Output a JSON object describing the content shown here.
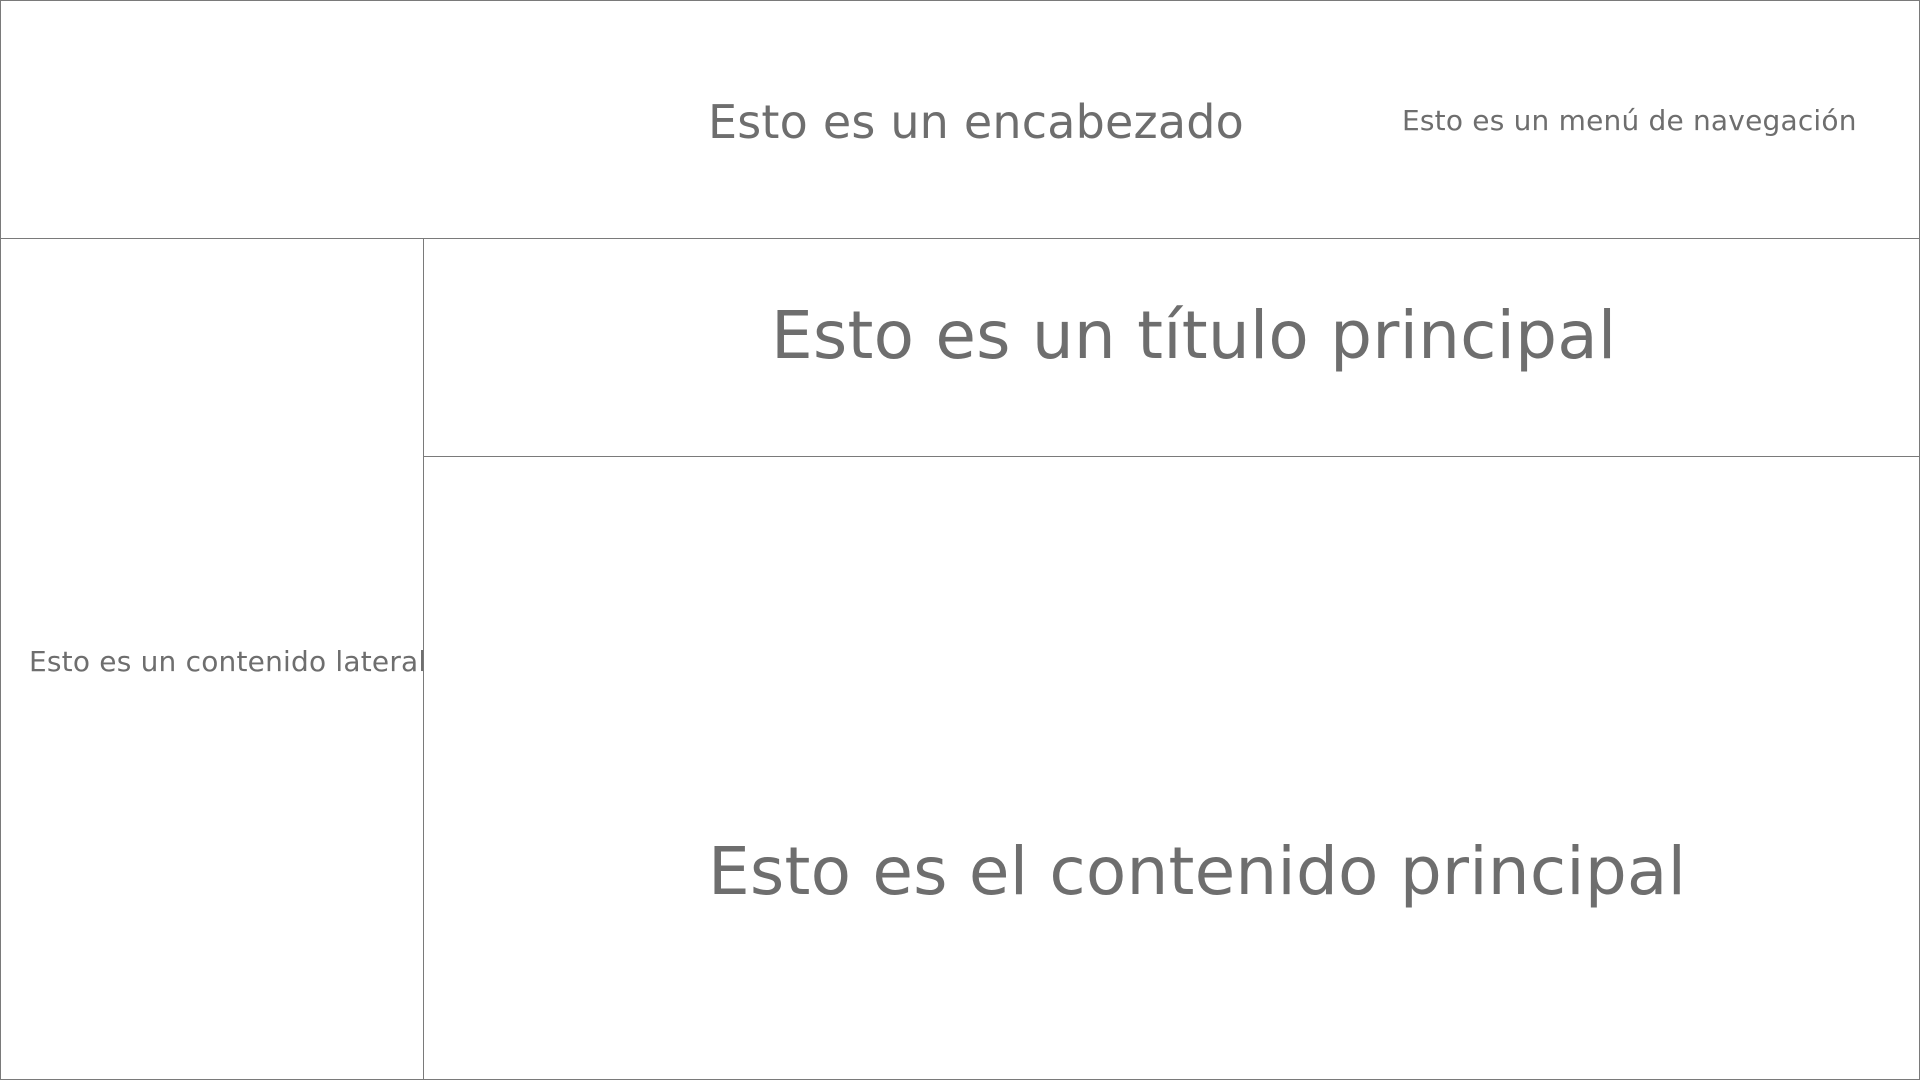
{
  "header": {
    "title": "Esto es un encabezado",
    "nav_menu": "Esto es un menú de navegación"
  },
  "main": {
    "title": "Esto es un título principal",
    "content": "Esto es el contenido principal"
  },
  "sidebar": {
    "content": "Esto es un contenido lateral"
  },
  "colors": {
    "border": "#7a7a7a",
    "text": "#6e6e6e",
    "background": "#ffffff"
  }
}
